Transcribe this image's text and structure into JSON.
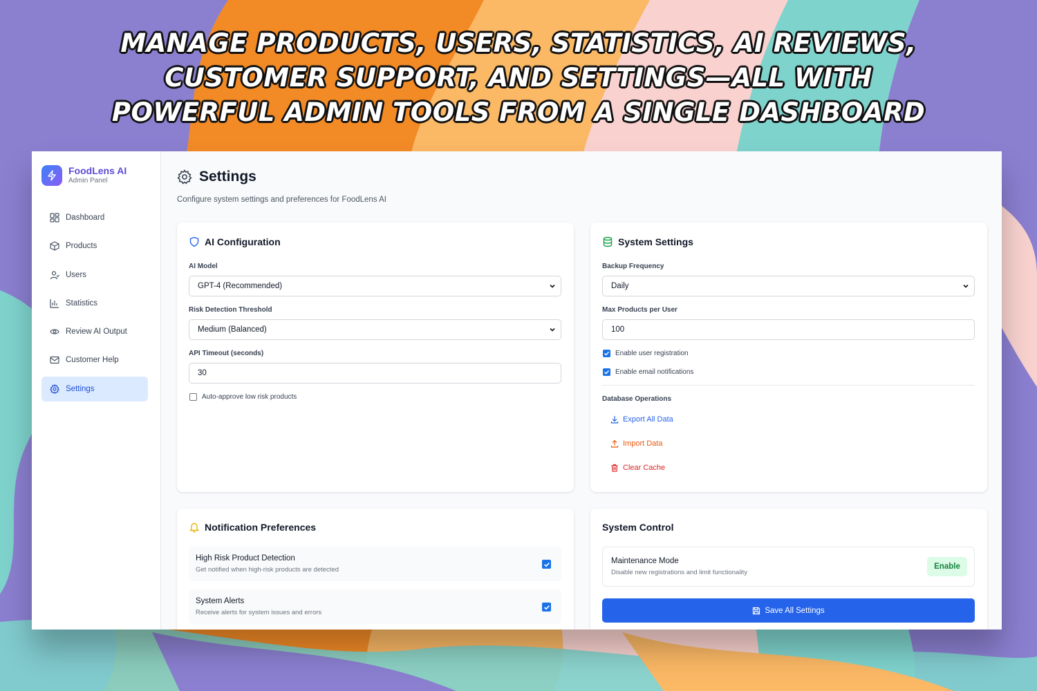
{
  "headline": "Manage products, users, statistics, AI reviews, customer support, and settings—all with powerful admin tools from a single dashboard",
  "colors": {
    "accent": "#2563eb",
    "brand": "#5b4bd6",
    "active_bg": "#dbeafe",
    "success": "#15803d",
    "warning": "#ea580c",
    "danger": "#dc2626"
  },
  "brand": {
    "name": "FoodLens AI",
    "subtitle": "Admin Panel"
  },
  "sidebar": {
    "items": [
      {
        "label": "Dashboard",
        "icon": "dashboard-icon"
      },
      {
        "label": "Products",
        "icon": "box-icon"
      },
      {
        "label": "Users",
        "icon": "users-icon"
      },
      {
        "label": "Statistics",
        "icon": "bar-chart-icon"
      },
      {
        "label": "Review AI Output",
        "icon": "eye-icon"
      },
      {
        "label": "Customer Help",
        "icon": "mail-icon"
      },
      {
        "label": "Settings",
        "icon": "gear-icon",
        "active": true
      }
    ]
  },
  "page": {
    "title": "Settings",
    "subtitle": "Configure system settings and preferences for FoodLens AI"
  },
  "ai_config": {
    "title": "AI Configuration",
    "model_label": "AI Model",
    "model_value": "GPT-4 (Recommended)",
    "risk_label": "Risk Detection Threshold",
    "risk_value": "Medium (Balanced)",
    "timeout_label": "API Timeout (seconds)",
    "timeout_value": "30",
    "auto_approve_label": "Auto-approve low risk products",
    "auto_approve_checked": false
  },
  "system_settings": {
    "title": "System Settings",
    "backup_label": "Backup Frequency",
    "backup_value": "Daily",
    "max_products_label": "Max Products per User",
    "max_products_value": "100",
    "registration_label": "Enable user registration",
    "registration_checked": true,
    "email_label": "Enable email notifications",
    "email_checked": true,
    "db_ops_label": "Database Operations",
    "export_label": "Export All Data",
    "import_label": "Import Data",
    "clear_label": "Clear Cache"
  },
  "notifications": {
    "title": "Notification Preferences",
    "items": [
      {
        "title": "High Risk Product Detection",
        "desc": "Get notified when high-risk products are detected",
        "checked": true
      },
      {
        "title": "System Alerts",
        "desc": "Receive alerts for system issues and errors",
        "checked": true
      }
    ]
  },
  "system_control": {
    "title": "System Control",
    "maintenance_title": "Maintenance Mode",
    "maintenance_desc": "Disable new registrations and limit functionality",
    "enable_label": "Enable",
    "save_label": "Save All Settings"
  }
}
